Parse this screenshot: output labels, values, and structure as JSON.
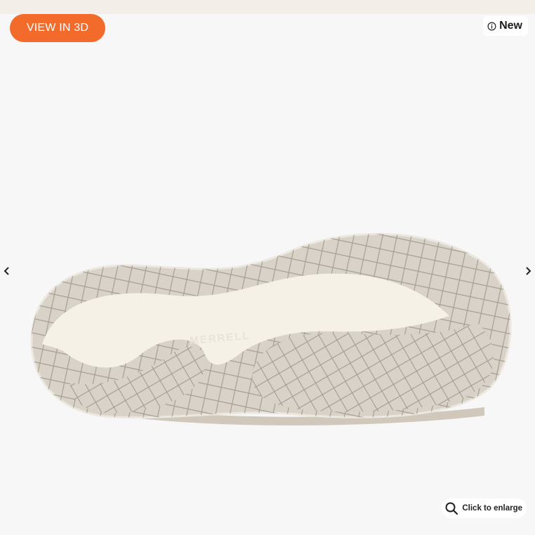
{
  "viewer": {
    "view_3d_label": "VIEW IN 3D",
    "badge_label": "New",
    "enlarge_label": "Click to enlarge",
    "product_image_alt": "Shoe outsole, bottom view",
    "sole_logo": "MERRELL"
  },
  "colors": {
    "accent": "#f26b2a",
    "background": "#f7f7f7",
    "top_strip": "#f3efe8",
    "sole_outer": "#d8d2c8",
    "sole_inner": "#f6f1e6",
    "tread_line": "#9e968a"
  },
  "icons": {
    "info": "info-icon",
    "prev": "chevron-left-icon",
    "next": "chevron-right-icon",
    "zoom": "search-icon"
  }
}
